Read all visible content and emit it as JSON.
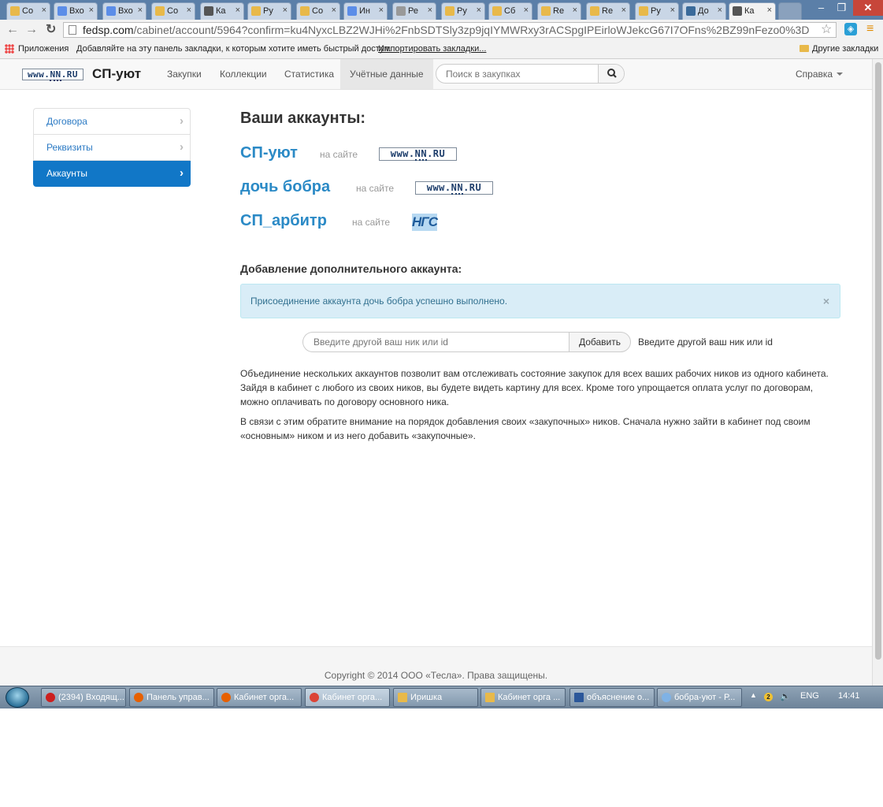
{
  "browser": {
    "tabs": [
      {
        "title": "Со",
        "icon": "page-icon",
        "color": "#e8b94a"
      },
      {
        "title": "Вхо",
        "icon": "google-icon",
        "color": "#5b8de8"
      },
      {
        "title": "Вхо",
        "icon": "google-icon",
        "color": "#5b8de8"
      },
      {
        "title": "Со",
        "icon": "page-icon",
        "color": "#e8b94a"
      },
      {
        "title": "Ка",
        "icon": "teapot-icon",
        "color": "#555555"
      },
      {
        "title": "Ру",
        "icon": "page-icon",
        "color": "#e8b94a"
      },
      {
        "title": "Со",
        "icon": "page-icon",
        "color": "#e8b94a"
      },
      {
        "title": "Ин",
        "icon": "google-icon",
        "color": "#5b8de8"
      },
      {
        "title": "Ре",
        "icon": "doc-icon",
        "color": "#999999"
      },
      {
        "title": "Ру",
        "icon": "page-icon",
        "color": "#e8b94a"
      },
      {
        "title": "Сб",
        "icon": "page-icon",
        "color": "#e8b94a"
      },
      {
        "title": "Re",
        "icon": "page-icon",
        "color": "#e8b94a"
      },
      {
        "title": "Re",
        "icon": "page-icon",
        "color": "#e8b94a"
      },
      {
        "title": "Ру",
        "icon": "page-icon",
        "color": "#e8b94a"
      },
      {
        "title": "До",
        "icon": "mail-icon",
        "color": "#3a6a9a"
      },
      {
        "title": "Ка",
        "icon": "teapot-icon",
        "color": "#555555",
        "active": true
      }
    ],
    "url_host": "fedsp.com",
    "url_path": "/cabinet/account/5964?confirm=ku4NyxcLBZ2WJHi%2FnbSDTSly3zp9jqIYMWRxy3rACSpgIPEirloWJekcG67I7OFns%2BZ99nFezo0%3D"
  },
  "bookmarks": {
    "apps_label": "Приложения",
    "hint": "Добавляйте на эту панель закладки, к которым хотите иметь быстрый доступ.",
    "import_link": "Импортировать закладки...",
    "other_label": "Другие закладки"
  },
  "site": {
    "logo_prefix": "www.",
    "logo_nn": "NN",
    "logo_suffix": ".RU",
    "brand": "СП-уют",
    "nav": [
      "Закупки",
      "Коллекции",
      "Статистика",
      "Учётные данные"
    ],
    "nav_active": "Учётные данные",
    "search_placeholder": "Поиск в закупках",
    "help": "Справка"
  },
  "sidebar": {
    "items": [
      {
        "label": "Договора",
        "active": false
      },
      {
        "label": "Реквизиты",
        "active": false
      },
      {
        "label": "Аккаунты",
        "active": true
      }
    ]
  },
  "main": {
    "heading": "Ваши аккаунты:",
    "on_site_label": "на сайте",
    "accounts": [
      {
        "name": "СП-уют",
        "site": "NN.RU"
      },
      {
        "name": "дочь бобра",
        "site": "NN.RU"
      },
      {
        "name": "СП_арбитр",
        "site": "НГС"
      }
    ],
    "add_heading": "Добавление дополнительного аккаунта:",
    "alert": "Присоединение аккаунта дочь бобра успешно выполнено.",
    "alert_close": "×",
    "input_placeholder": "Введите другой ваш ник или id",
    "add_button": "Добавить",
    "add_hint": "Введите другой ваш ник или id",
    "paragraph1": "Объединение нескольких аккаунтов позволит вам отслеживать состояние закупок для всех ваших рабочих ников из одного кабинета. Зайдя в кабинет с любого из своих ников, вы будете видеть картину для всех. Кроме того упрощается оплата услуг по договорам, можно оплачивать по договору основного ника.",
    "paragraph2": "В связи с этим обратите внимание на порядок добавления своих «закупочных» ников. Сначала нужно зайти в кабинет под своим «основным» ником и из него добавить «закупочные»."
  },
  "footer": {
    "copyright": "Copyright © 2014 ООО «Тесла». Права защищены."
  },
  "taskbar": {
    "items": [
      {
        "label": "(2394) Входящ...",
        "icon": "opera-icon",
        "color": "#cc1f1f"
      },
      {
        "label": "Панель управ...",
        "icon": "firefox-icon",
        "color": "#e66000"
      },
      {
        "label": "Кабинет орга...",
        "icon": "firefox-icon",
        "color": "#e66000"
      },
      {
        "label": "Кабинет орга...",
        "icon": "chrome-icon",
        "color": "#db4437",
        "active": true
      },
      {
        "label": "Иришка",
        "icon": "folder-icon",
        "color": "#e8b94a"
      },
      {
        "label": "Кабинет орга ...",
        "icon": "folder-icon",
        "color": "#e8b94a"
      },
      {
        "label": "объяснение о...",
        "icon": "word-icon",
        "color": "#2b579a"
      },
      {
        "label": "бобра-уют - Р...",
        "icon": "paint-icon",
        "color": "#7fb2e5"
      }
    ],
    "tray_badge": "2",
    "language": "ENG",
    "time": "14:41"
  }
}
